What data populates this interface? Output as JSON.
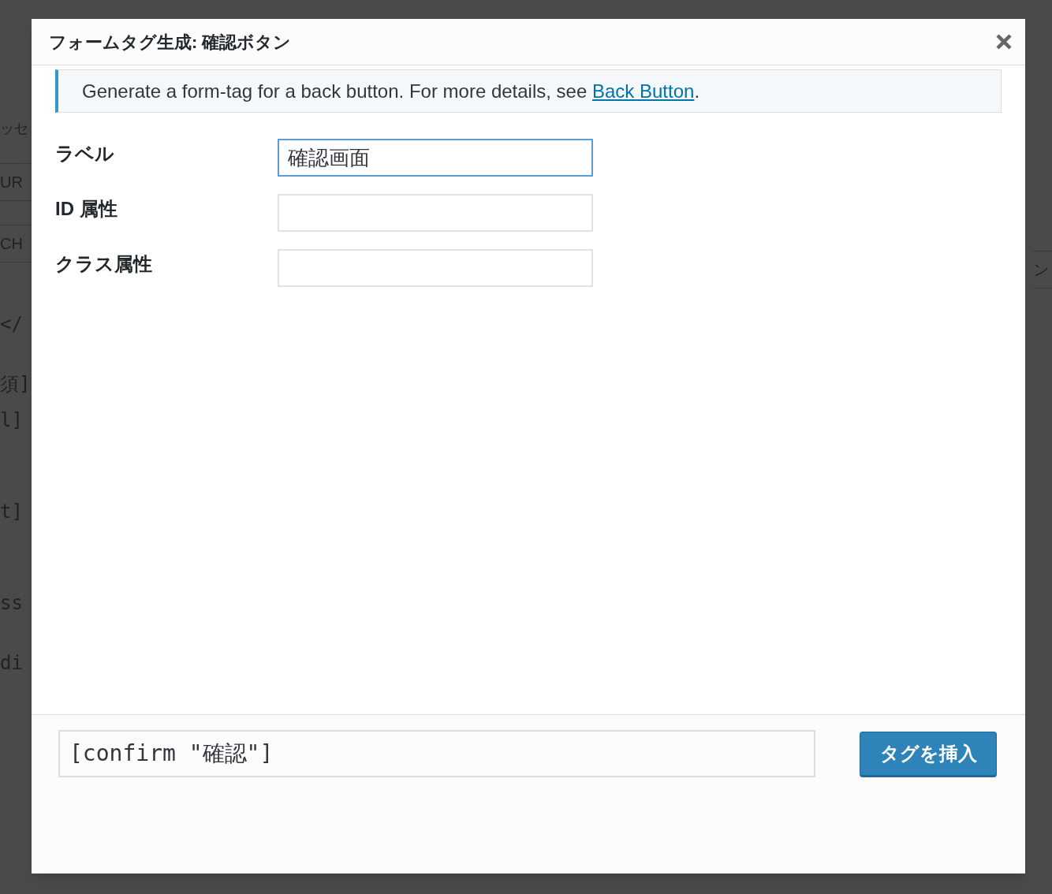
{
  "backdrop": {
    "left_fragments": [
      {
        "text": "ッセ",
        "kind": "tab"
      },
      {
        "text": "UR",
        "kind": "button"
      },
      {
        "text": "CH",
        "kind": "button"
      },
      {
        "text": "</",
        "kind": "code"
      },
      {
        "text": "須]",
        "kind": "code"
      },
      {
        "text": "l]",
        "kind": "code"
      },
      {
        "text": "t]",
        "kind": "code"
      },
      {
        "text": "ss",
        "kind": "code"
      },
      {
        "text": "di",
        "kind": "code"
      }
    ],
    "right_fragments": [
      {
        "text": "ン",
        "kind": "button"
      }
    ]
  },
  "dialog": {
    "title": "フォームタグ生成: 確認ボタン",
    "notice": {
      "text": "Generate a form-tag for a back button. For more details, see ",
      "link": "Back Button",
      "after": "."
    },
    "fields": [
      {
        "label": "ラベル",
        "value": "確認画面",
        "focused": true
      },
      {
        "label": "ID 属性",
        "focused": false
      },
      {
        "label": "クラス属性",
        "focused": false
      }
    ],
    "tag_output": "[confirm \"確認\"]",
    "insert_button": "タグを挿入"
  }
}
